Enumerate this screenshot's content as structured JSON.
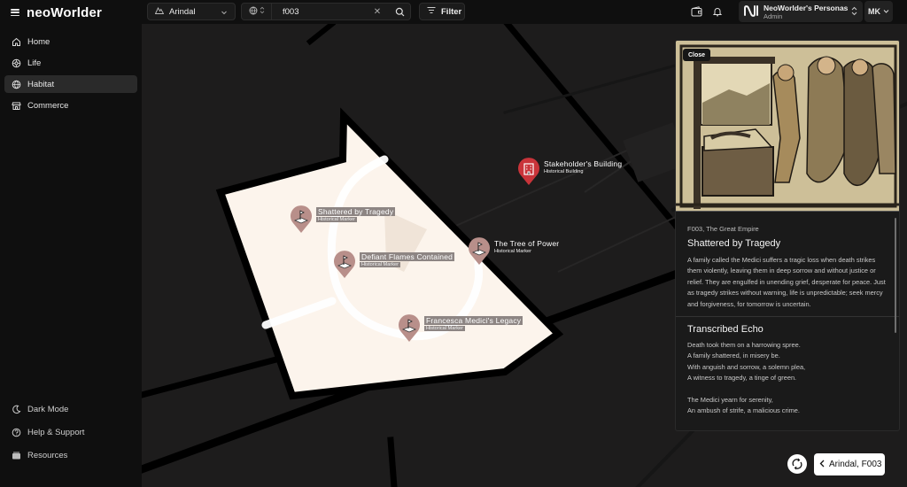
{
  "app": {
    "logo": "neoWorlder"
  },
  "sidebar": {
    "items": [
      {
        "label": "Home",
        "icon": "home-icon"
      },
      {
        "label": "Life",
        "icon": "life-icon"
      },
      {
        "label": "Habitat",
        "icon": "habitat-icon",
        "active": true
      },
      {
        "label": "Commerce",
        "icon": "store-icon"
      }
    ],
    "bottom": [
      {
        "label": "Dark Mode",
        "icon": "moon-icon"
      },
      {
        "label": "Help & Support",
        "icon": "help-icon"
      },
      {
        "label": "Resources",
        "icon": "resources-icon"
      }
    ]
  },
  "topbar": {
    "location": "Arindal",
    "search_value": "f003",
    "filter_label": "Filter",
    "persona_name": "NeoWorlder's Personas",
    "persona_role": "Admin",
    "user_initials": "MK"
  },
  "map": {
    "markers": [
      {
        "name": "Stakeholder's Building",
        "type": "Historical Building",
        "icon": "building-icon",
        "color": "#c9343a"
      },
      {
        "name": "Shattered by Tragedy",
        "type": "Historical Marker",
        "icon": "flag-icon",
        "color": "#b88f8a"
      },
      {
        "name": "The Tree of Power",
        "type": "Historical Marker",
        "icon": "flag-icon",
        "color": "#b88f8a"
      },
      {
        "name": "Defiant Flames Contained",
        "type": "Historical Marker",
        "icon": "flag-icon",
        "color": "#b88f8a"
      },
      {
        "name": "Francesca Medici's Legacy",
        "type": "Historical Marker",
        "icon": "flag-icon",
        "color": "#b88f8a"
      }
    ],
    "zone_color": "#fcf4ec",
    "back_label": "Arindal, F003"
  },
  "panel": {
    "close_label": "Close",
    "kicker": "F003, The Great Empire",
    "title": "Shattered by Tragedy",
    "description": "A family called the Medici suffers a tragic loss when death strikes them violently, leaving them in deep sorrow and without justice or relief. They are engulfed in unending grief, desperate for peace. Just as tragedy strikes without warning, life is unpredictable; seek mercy and forgiveness, for tomorrow is uncertain.",
    "section_title": "Transcribed Echo",
    "poem": [
      "Death took them on a harrowing spree.",
      "A family shattered, in misery be.",
      "With anguish and sorrow, a solemn plea,",
      "A witness to tragedy, a tinge of green.",
      "",
      "The Medici yearn for serenity,",
      "An ambush of strife, a malicious crime."
    ]
  }
}
